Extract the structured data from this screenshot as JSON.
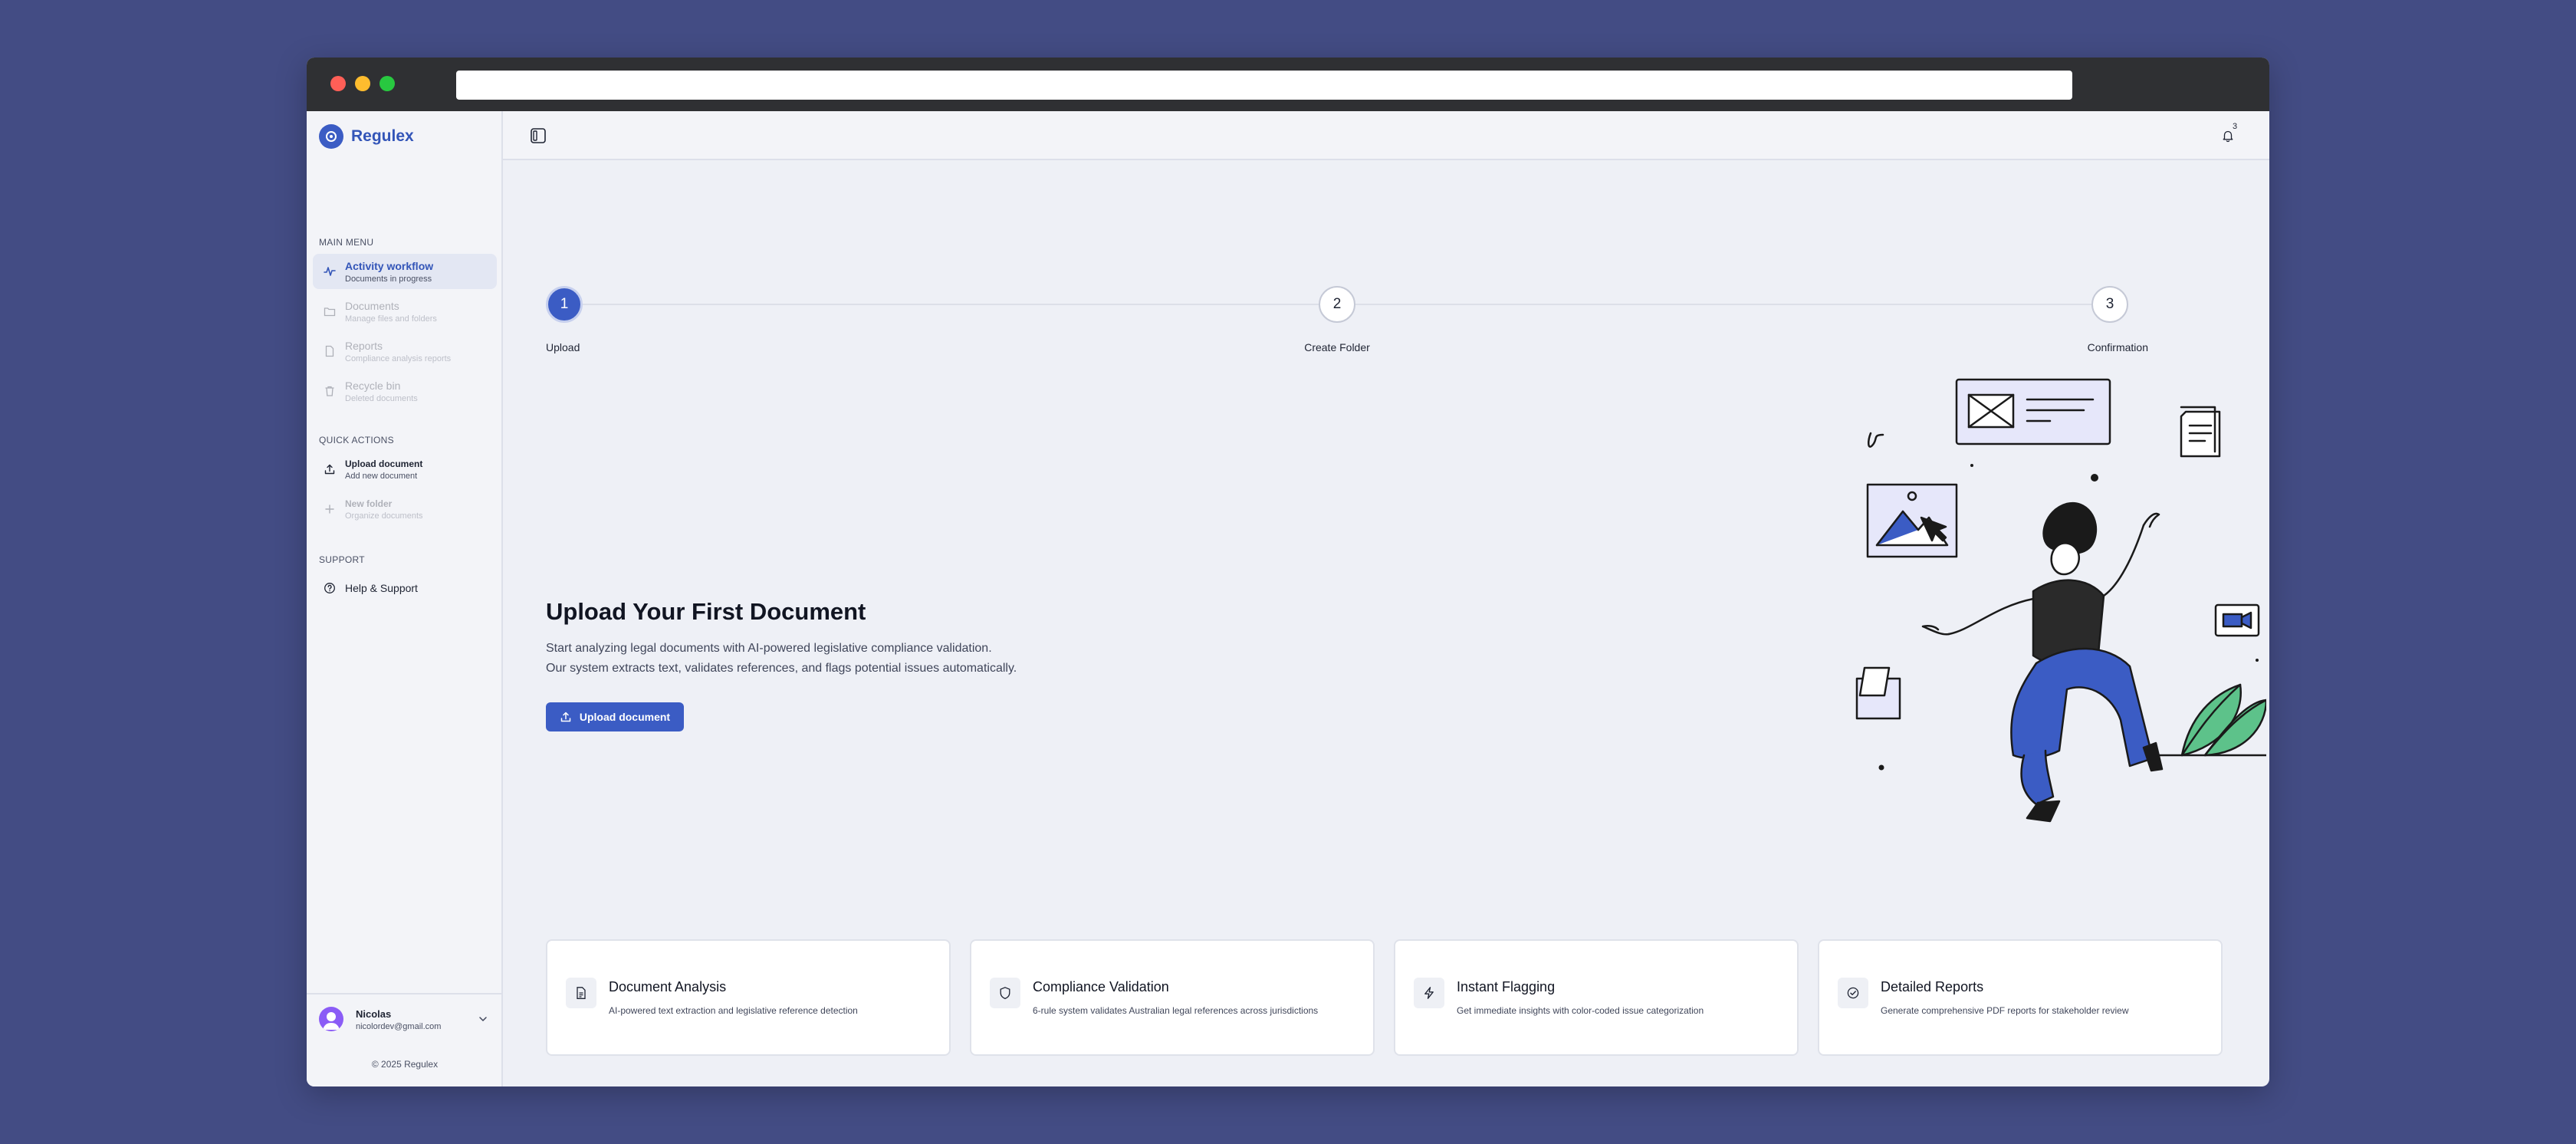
{
  "brand": {
    "name": "Regulex",
    "accent": "#3b5cc4"
  },
  "sidebar": {
    "main_menu_label": "MAIN MENU",
    "main_items": [
      {
        "title": "Activity workflow",
        "subtitle": "Documents in progress",
        "icon": "activity-icon",
        "state": "active"
      },
      {
        "title": "Documents",
        "subtitle": "Manage files and folders",
        "icon": "folder-icon",
        "state": "disabled"
      },
      {
        "title": "Reports",
        "subtitle": "Compliance analysis reports",
        "icon": "file-icon",
        "state": "disabled"
      },
      {
        "title": "Recycle bin",
        "subtitle": "Deleted documents",
        "icon": "trash-icon",
        "state": "disabled"
      }
    ],
    "quick_actions_label": "QUICK ACTIONS",
    "quick_actions": [
      {
        "title": "Upload document",
        "subtitle": "Add new document",
        "icon": "upload-icon",
        "state": "enabled"
      },
      {
        "title": "New folder",
        "subtitle": "Organize documents",
        "icon": "plus-icon",
        "state": "disabled"
      }
    ],
    "support_label": "SUPPORT",
    "support_items": [
      {
        "title": "Help & Support",
        "icon": "help-icon"
      }
    ],
    "user": {
      "name": "Nicolas",
      "email": "nicolordev@gmail.com"
    },
    "copyright": "© 2025 Regulex"
  },
  "topbar": {
    "notification_count": "3"
  },
  "stepper": {
    "steps": [
      {
        "number": "1",
        "label": "Upload",
        "state": "done"
      },
      {
        "number": "2",
        "label": "Create Folder",
        "state": "todo"
      },
      {
        "number": "3",
        "label": "Confirmation",
        "state": "todo"
      }
    ]
  },
  "hero": {
    "title": "Upload Your First Document",
    "desc_line1": "Start analyzing legal documents with AI-powered legislative compliance validation.",
    "desc_line2": "Our system extracts text, validates references, and flags potential issues automatically.",
    "button_label": "Upload document"
  },
  "features": [
    {
      "title": "Document Analysis",
      "desc": "AI-powered text extraction and legislative reference detection",
      "icon": "document-icon"
    },
    {
      "title": "Compliance Validation",
      "desc": "6-rule system validates Australian legal references across jurisdictions",
      "icon": "shield-icon"
    },
    {
      "title": "Instant Flagging",
      "desc": "Get immediate insights with color-coded issue categorization",
      "icon": "lightning-icon"
    },
    {
      "title": "Detailed Reports",
      "desc": "Generate comprehensive PDF reports for stakeholder review",
      "icon": "check-circle-icon"
    }
  ]
}
